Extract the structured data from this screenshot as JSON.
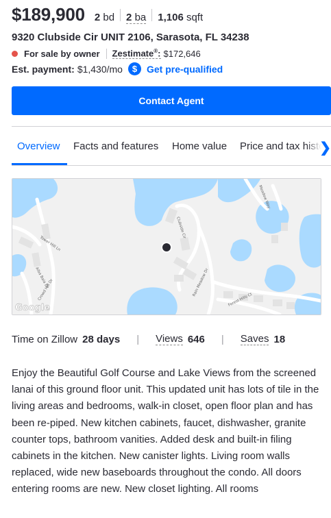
{
  "listing": {
    "price": "$189,900",
    "beds_num": "2",
    "beds_unit": "bd",
    "baths_num": "2",
    "baths_unit": "ba",
    "sqft_num": "1,106",
    "sqft_unit": "sqft",
    "address": "9320 Clubside Cir UNIT 2106, Sarasota, FL 34238",
    "status": "For sale by owner",
    "zestimate_label": "Zestimate",
    "zestimate_reg": "®",
    "zestimate_value": "$172,646",
    "payment_label": "Est. payment:",
    "payment_value": "$1,430/mo",
    "payment_icon": "dollar-icon",
    "prequal_link": "Get pre-qualified"
  },
  "contact_button": "Contact Agent",
  "tabs": [
    {
      "label": "Overview",
      "active": true
    },
    {
      "label": "Facts and features"
    },
    {
      "label": "Home value"
    },
    {
      "label": "Price and tax history"
    }
  ],
  "map": {
    "streets": [
      "Tower Hill Ln",
      "Clubside Cir",
      "Meadow Way",
      "Alba Bala Dr",
      "Crowd Hill Dr",
      "Rain Meadow Dr",
      "Forest Hills Ct"
    ],
    "watermark": "Google"
  },
  "stats": {
    "time_label": "Time on Zillow",
    "time_value": "28 days",
    "views_label": "Views",
    "views_value": "646",
    "saves_label": "Saves",
    "saves_value": "18"
  },
  "description": "Enjoy the Beautiful Golf Course and Lake Views from the screened lanai of this ground floor unit. This updated unit has lots of tile in the living areas and bedrooms, walk-in closet, open floor plan and has been re-piped. New kitchen cabinets, faucet, dishwasher, granite counter tops, bathroom vanities. Added desk and built-in filing cabinets in the kitchen. New canister lights. Living room walls replaced, wide new baseboards throughout the condo. All doors entering rooms are new. New closet lighting. All rooms",
  "colors": {
    "accent": "#006aff",
    "status_dot": "#e5544b",
    "water": "#aadaff"
  }
}
